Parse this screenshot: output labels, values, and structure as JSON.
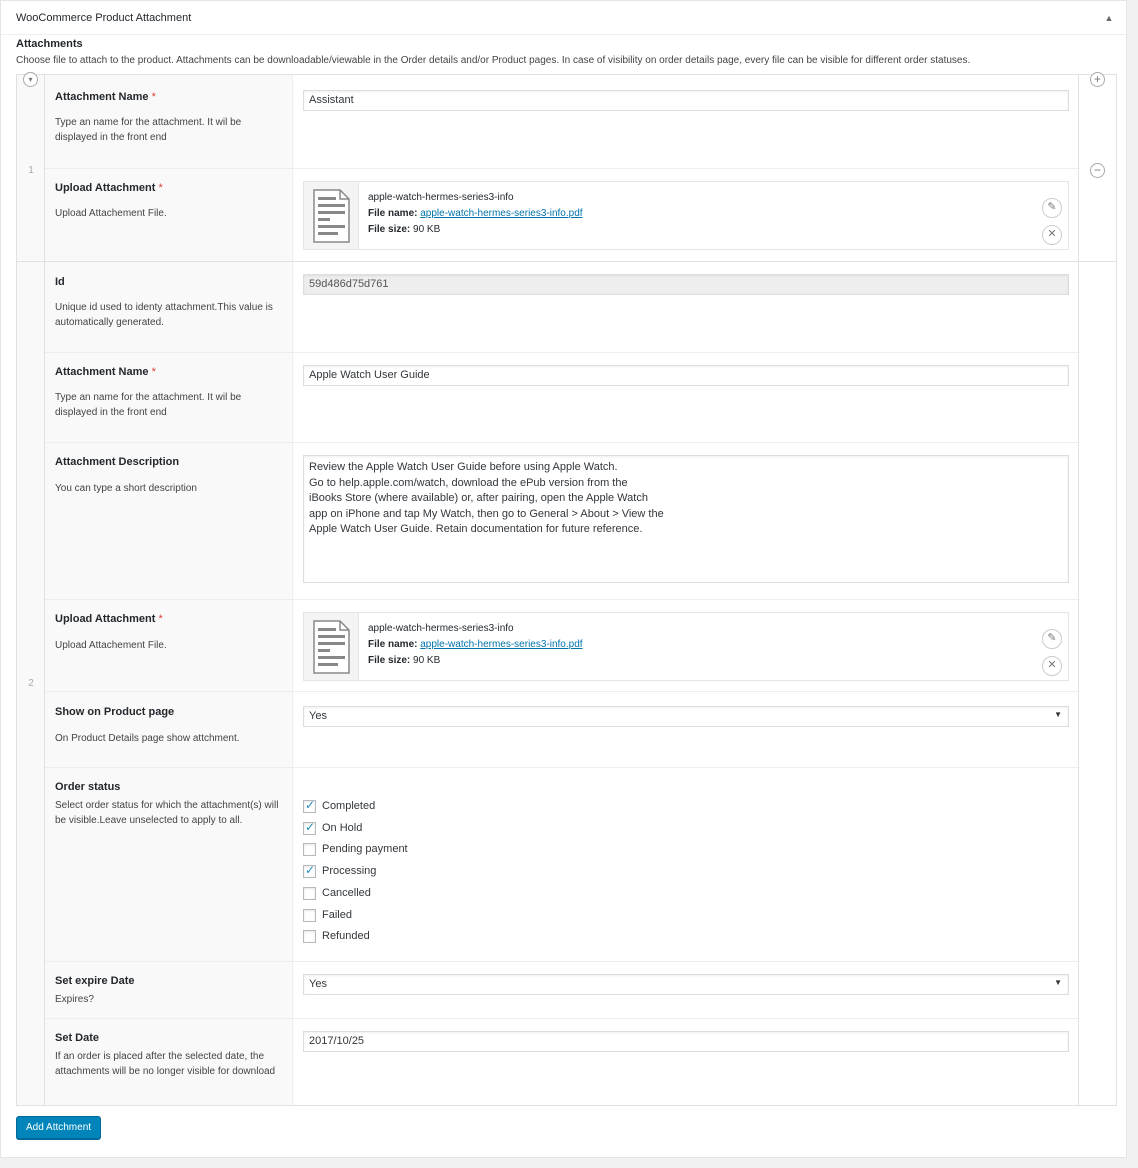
{
  "box": {
    "title": "WooCommerce Product Attachment",
    "toggle_icon": "▲"
  },
  "section": {
    "label": "Attachments",
    "description": "Choose file to attach to the product. Attachments can be downloadable/viewable in the Order details and/or Product pages. In case of visibility on order details page, every file can be visible for different order statuses."
  },
  "row1": {
    "number": "1",
    "name_label": "Attachment Name",
    "name_desc": "Type an name for the attachment. It wil be displayed in the front end",
    "name_value": "Assistant",
    "upload_label": "Upload Attachment",
    "upload_desc": "Upload Attachement File.",
    "file_title": "apple-watch-hermes-series3-info",
    "file_name_label": "File name:",
    "file_name": "apple-watch-hermes-series3-info.pdf",
    "file_size_label": "File size:",
    "file_size": "90 KB"
  },
  "row2": {
    "number": "2",
    "id_label": "Id",
    "id_desc": "Unique id used to identy attachment.This value is automatically generated.",
    "id_value": "59d486d75d761",
    "name_label": "Attachment Name",
    "name_desc": "Type an name for the attachment. It wil be displayed in the front end",
    "name_value": "Apple Watch User Guide",
    "desc_label": "Attachment Description",
    "desc_desc": "You can type a short description",
    "desc_value": "Review the Apple Watch User Guide before using Apple Watch.\nGo to help.apple.com/watch, download the ePub version from the\niBooks Store (where available) or, after pairing, open the Apple Watch\napp on iPhone and tap My Watch, then go to General > About > View the\nApple Watch User Guide. Retain documentation for future reference.",
    "upload_label": "Upload Attachment",
    "upload_desc": "Upload Attachement File.",
    "file_title": "apple-watch-hermes-series3-info",
    "file_name_label": "File name:",
    "file_name": "apple-watch-hermes-series3-info.pdf",
    "file_size_label": "File size:",
    "file_size": "90 KB",
    "show_label": "Show on Product page",
    "show_desc": "On Product Details page show attchment.",
    "show_value": "Yes",
    "status_label": "Order status",
    "status_desc": "Select order status for which the attachment(s) will be visible.Leave unselected to apply to all.",
    "statuses": [
      {
        "label": "Completed",
        "checked": true
      },
      {
        "label": "On Hold",
        "checked": true
      },
      {
        "label": "Pending payment",
        "checked": false
      },
      {
        "label": "Processing",
        "checked": true
      },
      {
        "label": "Cancelled",
        "checked": false
      },
      {
        "label": "Failed",
        "checked": false
      },
      {
        "label": "Refunded",
        "checked": false
      }
    ],
    "expire_label": "Set expire Date",
    "expire_desc": "Expires?",
    "expire_value": "Yes",
    "date_label": "Set Date",
    "date_desc": "If an order is placed after the selected date, the attachments will be no longer visible for download",
    "date_value": "2017/10/25"
  },
  "required_mark": "*",
  "add_button": "Add Attchment",
  "colors": {
    "primary_button": "#0085ba",
    "link": "#0073aa",
    "check": "#1e8cbe",
    "required": "#dd3d36"
  }
}
